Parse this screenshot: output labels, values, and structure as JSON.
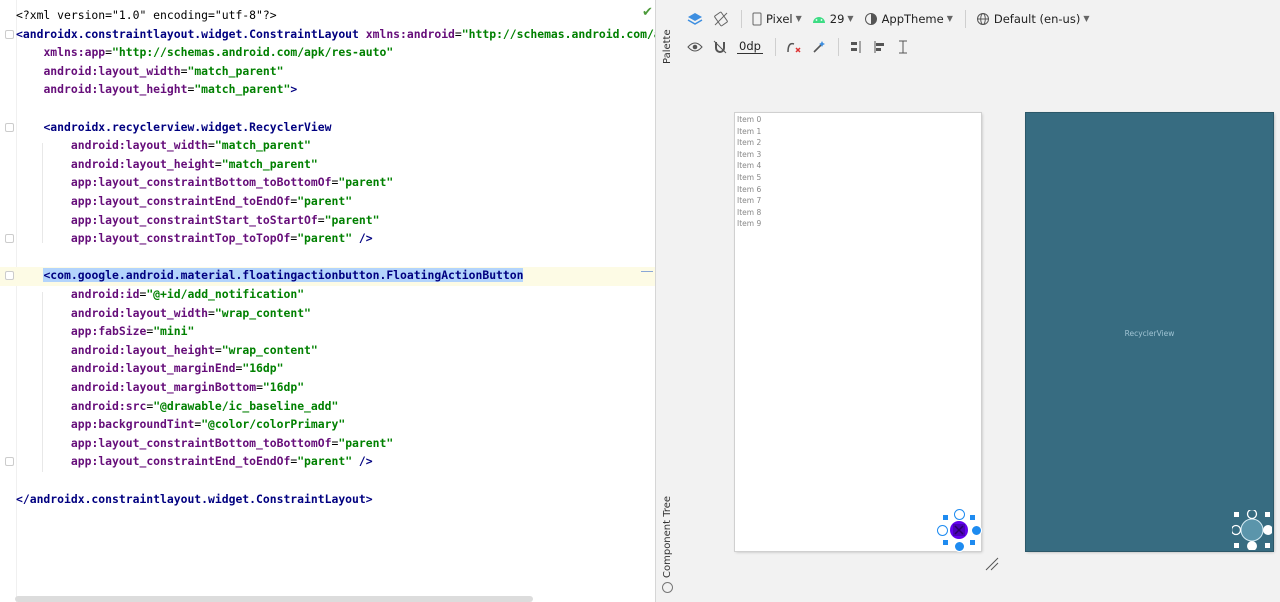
{
  "editor": {
    "lines": [
      [
        {
          "t": "<?xml version=\"1.0\" encoding=\"utf-8\"?>",
          "c": "pl"
        }
      ],
      [
        {
          "t": "<androidx.constraintlayout.widget.ConstraintLayout ",
          "c": "tg"
        },
        {
          "t": "xmlns:",
          "c": "at"
        },
        {
          "t": "android",
          "c": "at"
        },
        {
          "t": "=",
          "c": "pl"
        },
        {
          "t": "\"http://schemas.android.com/ap",
          "c": "vl"
        }
      ],
      [
        {
          "t": "    ",
          "c": "pl"
        },
        {
          "t": "xmlns:",
          "c": "at"
        },
        {
          "t": "app",
          "c": "at"
        },
        {
          "t": "=",
          "c": "pl"
        },
        {
          "t": "\"http://schemas.android.com/apk/res-auto\"",
          "c": "vl"
        }
      ],
      [
        {
          "t": "    ",
          "c": "pl"
        },
        {
          "t": "android:",
          "c": "at"
        },
        {
          "t": "layout_width",
          "c": "at"
        },
        {
          "t": "=",
          "c": "pl"
        },
        {
          "t": "\"match_parent\"",
          "c": "vl"
        }
      ],
      [
        {
          "t": "    ",
          "c": "pl"
        },
        {
          "t": "android:",
          "c": "at"
        },
        {
          "t": "layout_height",
          "c": "at"
        },
        {
          "t": "=",
          "c": "pl"
        },
        {
          "t": "\"match_parent\"",
          "c": "vl"
        },
        {
          "t": ">",
          "c": "tg"
        }
      ],
      [],
      [
        {
          "t": "    ",
          "c": "pl"
        },
        {
          "t": "<androidx.recyclerview.widget.RecyclerView",
          "c": "tg"
        }
      ],
      [
        {
          "t": "        ",
          "c": "pl"
        },
        {
          "t": "android:",
          "c": "at"
        },
        {
          "t": "layout_width",
          "c": "at"
        },
        {
          "t": "=",
          "c": "pl"
        },
        {
          "t": "\"match_parent\"",
          "c": "vl"
        }
      ],
      [
        {
          "t": "        ",
          "c": "pl"
        },
        {
          "t": "android:",
          "c": "at"
        },
        {
          "t": "layout_height",
          "c": "at"
        },
        {
          "t": "=",
          "c": "pl"
        },
        {
          "t": "\"match_parent\"",
          "c": "vl"
        }
      ],
      [
        {
          "t": "        ",
          "c": "pl"
        },
        {
          "t": "app:",
          "c": "at"
        },
        {
          "t": "layout_constraintBottom_toBottomOf",
          "c": "at"
        },
        {
          "t": "=",
          "c": "pl"
        },
        {
          "t": "\"parent\"",
          "c": "vl"
        }
      ],
      [
        {
          "t": "        ",
          "c": "pl"
        },
        {
          "t": "app:",
          "c": "at"
        },
        {
          "t": "layout_constraintEnd_toEndOf",
          "c": "at"
        },
        {
          "t": "=",
          "c": "pl"
        },
        {
          "t": "\"parent\"",
          "c": "vl"
        }
      ],
      [
        {
          "t": "        ",
          "c": "pl"
        },
        {
          "t": "app:",
          "c": "at"
        },
        {
          "t": "layout_constraintStart_toStartOf",
          "c": "at"
        },
        {
          "t": "=",
          "c": "pl"
        },
        {
          "t": "\"parent\"",
          "c": "vl"
        }
      ],
      [
        {
          "t": "        ",
          "c": "pl"
        },
        {
          "t": "app:",
          "c": "at"
        },
        {
          "t": "layout_constraintTop_toTopOf",
          "c": "at"
        },
        {
          "t": "=",
          "c": "pl"
        },
        {
          "t": "\"parent\"",
          "c": "vl"
        },
        {
          "t": " />",
          "c": "tg"
        }
      ],
      [],
      [
        {
          "t": "    ",
          "c": "pl"
        },
        {
          "t": "<com.google.android.material.floatingactionbutton.",
          "c": "tg hl"
        },
        {
          "t": "FloatingActionButton",
          "c": "tg hl"
        }
      ],
      [
        {
          "t": "        ",
          "c": "pl"
        },
        {
          "t": "android:",
          "c": "at"
        },
        {
          "t": "id",
          "c": "at"
        },
        {
          "t": "=",
          "c": "pl"
        },
        {
          "t": "\"@+id/add_notification\"",
          "c": "vl"
        }
      ],
      [
        {
          "t": "        ",
          "c": "pl"
        },
        {
          "t": "android:",
          "c": "at"
        },
        {
          "t": "layout_width",
          "c": "at"
        },
        {
          "t": "=",
          "c": "pl"
        },
        {
          "t": "\"wrap_content\"",
          "c": "vl"
        }
      ],
      [
        {
          "t": "        ",
          "c": "pl"
        },
        {
          "t": "app:",
          "c": "at"
        },
        {
          "t": "fabSize",
          "c": "at"
        },
        {
          "t": "=",
          "c": "pl"
        },
        {
          "t": "\"mini\"",
          "c": "vl"
        }
      ],
      [
        {
          "t": "        ",
          "c": "pl"
        },
        {
          "t": "android:",
          "c": "at"
        },
        {
          "t": "layout_height",
          "c": "at"
        },
        {
          "t": "=",
          "c": "pl"
        },
        {
          "t": "\"wrap_content\"",
          "c": "vl"
        }
      ],
      [
        {
          "t": "        ",
          "c": "pl"
        },
        {
          "t": "android:",
          "c": "at"
        },
        {
          "t": "layout_marginEnd",
          "c": "at"
        },
        {
          "t": "=",
          "c": "pl"
        },
        {
          "t": "\"16dp\"",
          "c": "vl"
        }
      ],
      [
        {
          "t": "        ",
          "c": "pl"
        },
        {
          "t": "android:",
          "c": "at"
        },
        {
          "t": "layout_marginBottom",
          "c": "at"
        },
        {
          "t": "=",
          "c": "pl"
        },
        {
          "t": "\"16dp\"",
          "c": "vl"
        }
      ],
      [
        {
          "t": "        ",
          "c": "pl"
        },
        {
          "t": "android:",
          "c": "at"
        },
        {
          "t": "src",
          "c": "at"
        },
        {
          "t": "=",
          "c": "pl"
        },
        {
          "t": "\"@drawable/ic_baseline_add\"",
          "c": "vl"
        }
      ],
      [
        {
          "t": "        ",
          "c": "pl"
        },
        {
          "t": "app:",
          "c": "at"
        },
        {
          "t": "backgroundTint",
          "c": "at"
        },
        {
          "t": "=",
          "c": "pl"
        },
        {
          "t": "\"@color/colorPrimary\"",
          "c": "vl"
        }
      ],
      [
        {
          "t": "        ",
          "c": "pl"
        },
        {
          "t": "app:",
          "c": "at"
        },
        {
          "t": "layout_constraintBottom_toBottomOf",
          "c": "at"
        },
        {
          "t": "=",
          "c": "pl"
        },
        {
          "t": "\"parent\"",
          "c": "vl"
        }
      ],
      [
        {
          "t": "        ",
          "c": "pl"
        },
        {
          "t": "app:",
          "c": "at"
        },
        {
          "t": "layout_constraintEnd_toEndOf",
          "c": "at"
        },
        {
          "t": "=",
          "c": "pl"
        },
        {
          "t": "\"parent\"",
          "c": "vl"
        },
        {
          "t": " />",
          "c": "tg"
        }
      ],
      [],
      [
        {
          "t": "</androidx.constraintlayout.widget.ConstraintLayout>",
          "c": "tg"
        }
      ]
    ]
  },
  "side_strip": {
    "palette_label": "Palette",
    "component_tree_label": "Component Tree"
  },
  "toolbar": {
    "device": "Pixel",
    "api_level": "29",
    "theme": "AppTheme",
    "locale": "Default (en-us)",
    "margin": "0dp"
  },
  "preview": {
    "items": [
      "Item 0",
      "Item 1",
      "Item 2",
      "Item 3",
      "Item 4",
      "Item 5",
      "Item 6",
      "Item 7",
      "Item 8",
      "Item 9"
    ],
    "blueprint_label": "RecyclerView"
  },
  "colors": {
    "fab": "#6200ee",
    "selection": "#1e8bf0",
    "blueprint": "#376c81"
  }
}
